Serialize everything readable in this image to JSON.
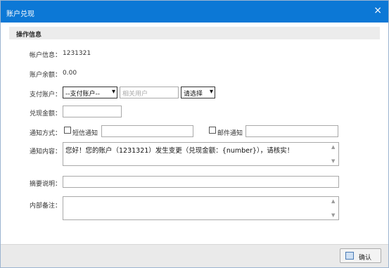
{
  "dialog": {
    "title": "账户兑现",
    "close_glyph": "×",
    "section_title": "操作信息"
  },
  "form": {
    "account_info": {
      "label": "帐户信息：",
      "value": "1231321"
    },
    "balance": {
      "label": "账户余额：",
      "value": "0.00"
    },
    "payment_account": {
      "label": "支付账户：",
      "select_value": "--支付账户--",
      "related_user_placeholder": "相关用户",
      "choose_value": "请选择"
    },
    "amount": {
      "label": "兑现金额：",
      "value": ""
    },
    "notify_method": {
      "label": "通知方式：",
      "sms_label": "短信通知",
      "email_label": "邮件通知",
      "sms_value": "",
      "email_value": ""
    },
    "notify_content": {
      "label": "通知内容：",
      "value": "您好！您的账户（1231321）发生变更（兑现金额：{number}），请核实！"
    },
    "summary": {
      "label": "摘要说明：",
      "value": ""
    },
    "internal_note": {
      "label": "内部备注：",
      "value": ""
    }
  },
  "footer": {
    "confirm_label": "确认"
  },
  "icons": {
    "close": "close-icon",
    "confirm": "confirm-icon",
    "dropdown": "chevron-down-icon"
  },
  "colors": {
    "titlebar": "#0c78d6",
    "section_bg": "#ececec",
    "footer_bg": "#eaeaea"
  }
}
